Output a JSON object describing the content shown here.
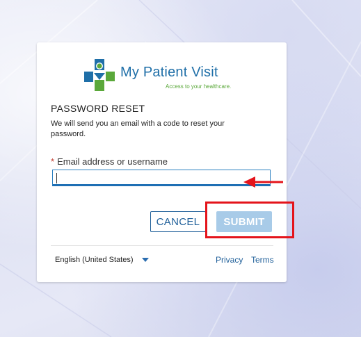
{
  "brand": {
    "name": "My Patient Visit",
    "tagline": "Access to your healthcare.",
    "logo_icon": "medical-cross-person-icon",
    "colors": {
      "blue": "#1f6fa8",
      "green": "#5aa83a"
    }
  },
  "form": {
    "heading": "PASSWORD RESET",
    "description": "We will send you an email with a code to reset your password.",
    "email_field": {
      "required_marker": "*",
      "label": "Email address or username",
      "value": "",
      "placeholder": ""
    },
    "cancel_label": "CANCEL",
    "submit_label": "SUBMIT"
  },
  "footer": {
    "language": "English (United States)",
    "privacy_label": "Privacy",
    "terms_label": "Terms"
  },
  "annotations": {
    "arrow_color": "#e4141b",
    "box_color": "#e4141b"
  }
}
